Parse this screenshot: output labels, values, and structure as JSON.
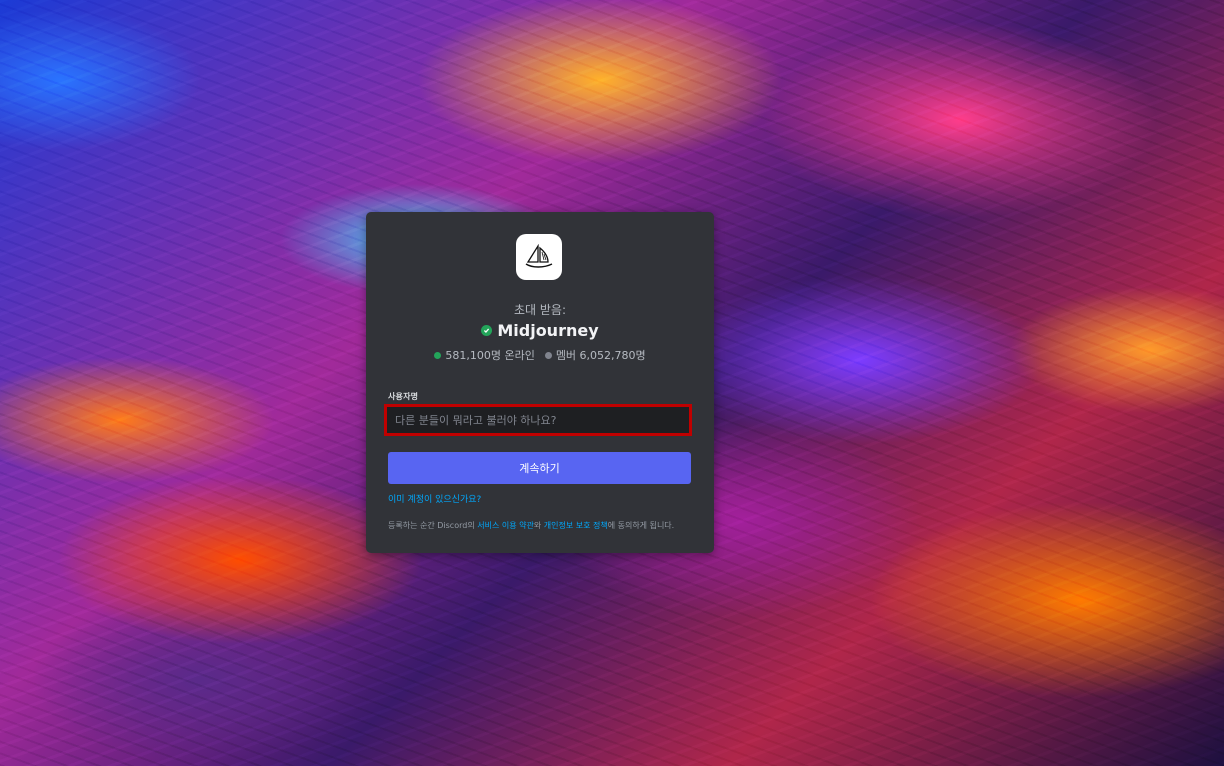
{
  "invite": {
    "invited_label": "초대 받음:",
    "server_name": "Midjourney",
    "online_count": "581,100명 온라인",
    "member_count": "멤버 6,052,780명"
  },
  "form": {
    "username_label": "사용자명",
    "username_placeholder": "다른 분들이 뭐라고 불러야 하나요?",
    "username_value": "",
    "continue_label": "계속하기",
    "login_link": "이미 계정이 있으신가요?"
  },
  "terms": {
    "prefix": "등록하는 순간 Discord의 ",
    "tos_link": "서비스 이용 약관",
    "middle": "와 ",
    "privacy_link": "개인정보 보호 정책",
    "suffix": "에 동의하게 됩니다."
  },
  "colors": {
    "modal_bg": "#313338",
    "accent_button": "#5865f2",
    "link": "#00a8fc",
    "online": "#23a55a",
    "highlight_border": "#c00000"
  },
  "icons": {
    "server_logo": "sailboat-icon",
    "verified": "verified-check-icon"
  }
}
